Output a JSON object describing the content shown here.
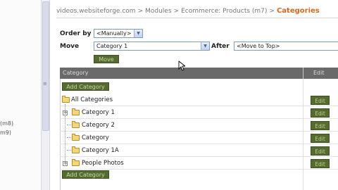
{
  "sidebar": {
    "texts": [
      "(m8)",
      "m9)",
      "",
      ""
    ]
  },
  "breadcrumb": {
    "items": [
      "videos.websiteforge.com",
      "Modules",
      "Ecommerce: Products (m7)"
    ],
    "separator": ">",
    "current": "Categories"
  },
  "order": {
    "label": "Order by",
    "value": "<Manually>"
  },
  "move": {
    "label": "Move",
    "value": "Category 1",
    "after_label": "After",
    "after_value": "<Move to Top>",
    "button_label": "Move"
  },
  "table": {
    "col_category": "Category",
    "col_edit": "Edit",
    "add_top_label": "Add Category",
    "add_bottom_label": "Add Category",
    "edit_label": "Edit",
    "rows": [
      {
        "label": "All Categories"
      },
      {
        "label": "Category 1"
      },
      {
        "label": "Category 2"
      },
      {
        "label": "Category"
      },
      {
        "label": "Category 1A"
      },
      {
        "label": "People Photos"
      }
    ]
  },
  "colors": {
    "accent": "#d2691e",
    "button_bg": "#556b2f",
    "header_bg": "#6a6a6a"
  }
}
